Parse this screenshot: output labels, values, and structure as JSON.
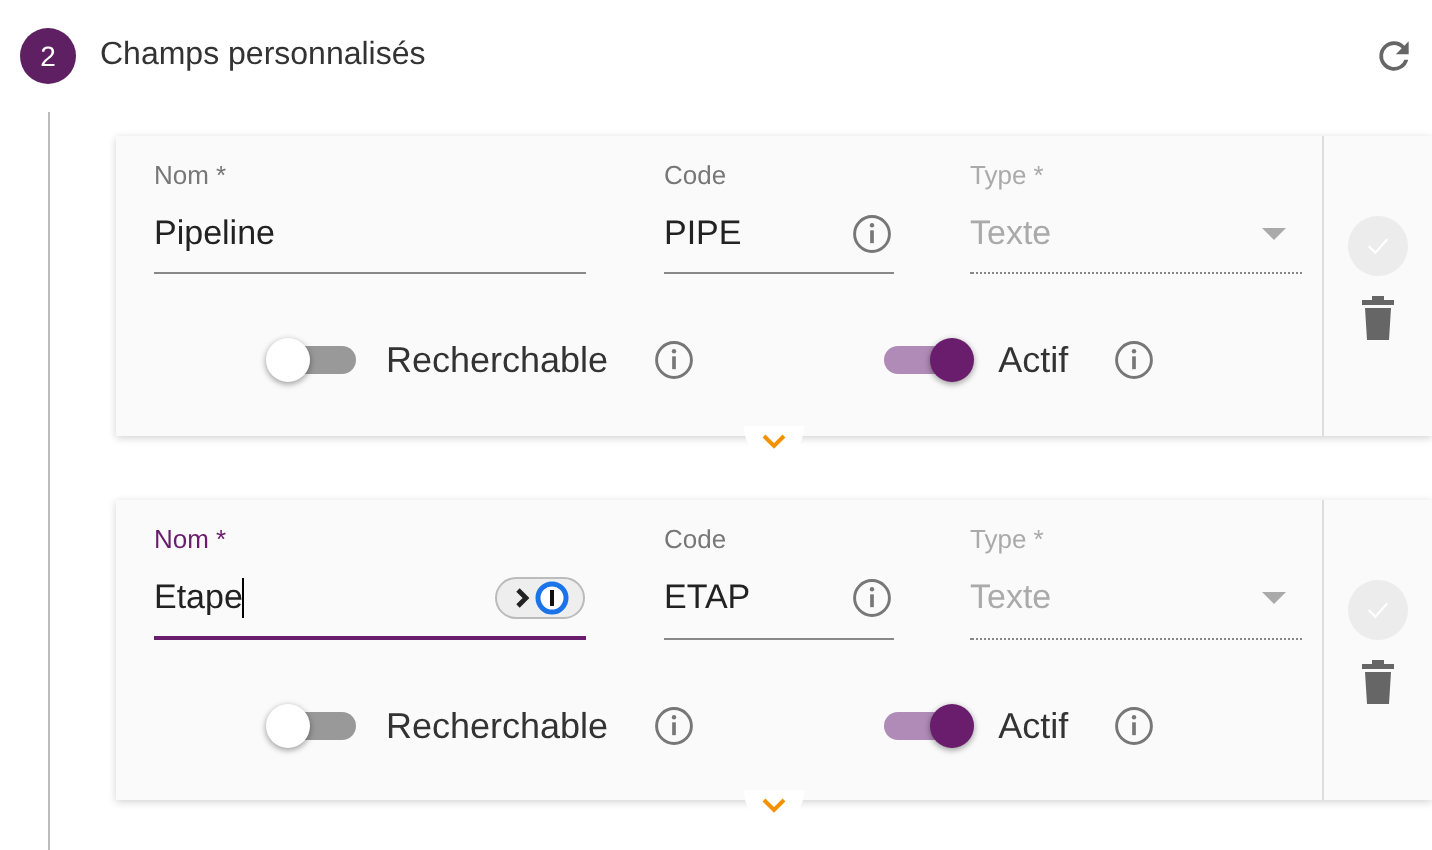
{
  "step": {
    "number": "2",
    "title": "Champs personnalisés"
  },
  "fields": [
    {
      "focused": false,
      "name": {
        "label": "Nom *",
        "value": "Pipeline"
      },
      "code": {
        "label": "Code",
        "value": "PIPE"
      },
      "type": {
        "label": "Type *",
        "value": "Texte",
        "disabled": true
      },
      "searchable": {
        "label": "Recherchable",
        "on": false
      },
      "active": {
        "label": "Actif",
        "on": true
      },
      "confirm_disabled": true
    },
    {
      "focused": true,
      "name": {
        "label": "Nom *",
        "value": "Etape"
      },
      "code": {
        "label": "Code",
        "value": "ETAP"
      },
      "type": {
        "label": "Type *",
        "value": "Texte",
        "disabled": true
      },
      "searchable": {
        "label": "Recherchable",
        "on": false
      },
      "active": {
        "label": "Actif",
        "on": true
      },
      "confirm_disabled": true
    }
  ]
}
